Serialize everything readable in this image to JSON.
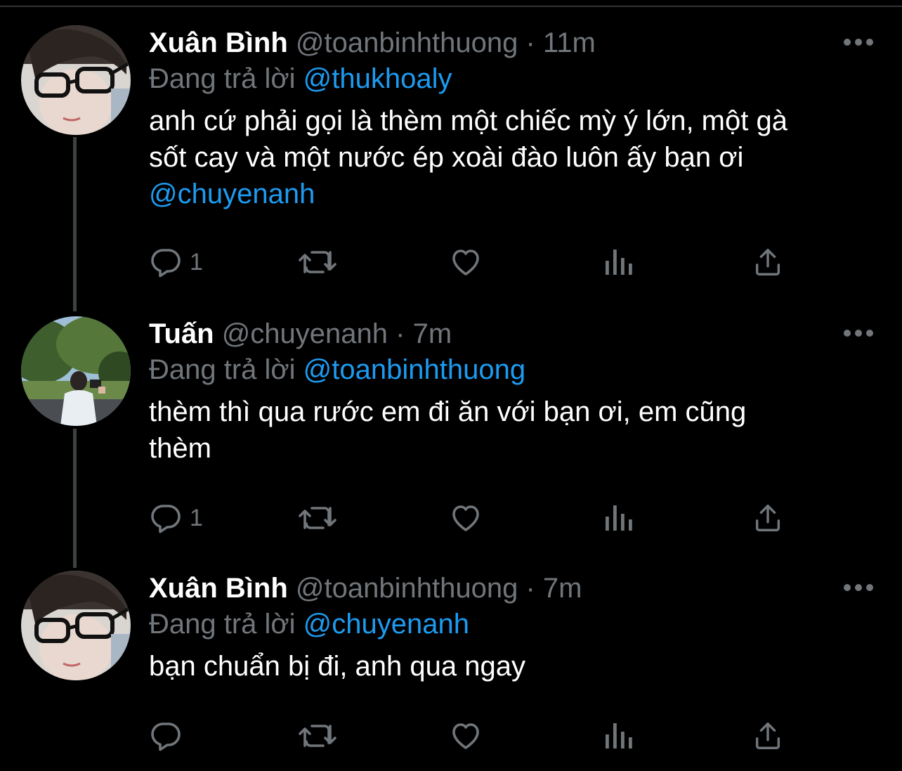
{
  "tweets": [
    {
      "name": "Xuân Bình",
      "handle": "@toanbinhthuong",
      "time": "11m",
      "reply_prefix": "Đang trả lời",
      "reply_to": "@thukhoaly",
      "text_lines": [
        "anh cứ phải gọi là thèm một chiếc mỳ ý lớn, một gà",
        "sốt cay và một nước ép xoài đào luôn ấy bạn ơi"
      ],
      "text_mention": "@chuyenanh",
      "reply_count": "1"
    },
    {
      "name": "Tuấn",
      "handle": "@chuyenanh",
      "time": "7m",
      "reply_prefix": "Đang trả lời",
      "reply_to": "@toanbinhthuong",
      "text_lines": [
        "thèm thì qua rước em đi ăn với bạn ơi, em cũng",
        "thèm"
      ],
      "reply_count": "1"
    },
    {
      "name": "Xuân Bình",
      "handle": "@toanbinhthuong",
      "time": "7m",
      "reply_prefix": "Đang trả lời",
      "reply_to": "@chuyenanh",
      "text_lines": [
        "bạn chuẩn bị đi, anh qua ngay"
      ],
      "reply_count": ""
    }
  ],
  "separator": "·",
  "colors": {
    "background": "#000000",
    "text": "#ffffff",
    "muted": "#71767b",
    "link": "#1d9bf0",
    "thread_line": "#3e4144"
  },
  "icons": {
    "reply": "speech-bubble-icon",
    "retweet": "retweet-icon",
    "like": "heart-icon",
    "views": "bar-chart-icon",
    "share": "share-upload-icon",
    "more": "three-dots-icon"
  }
}
